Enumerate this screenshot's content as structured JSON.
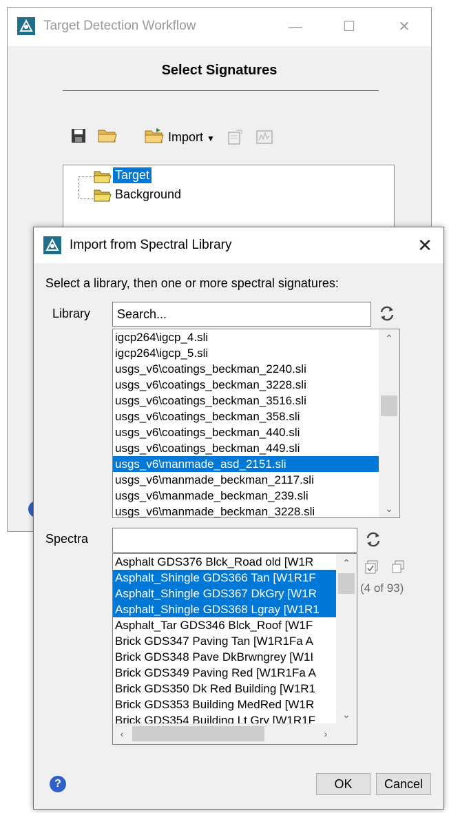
{
  "main_window": {
    "title": "Target Detection Workflow",
    "heading": "Select Signatures",
    "toolbar": {
      "import_label": "Import"
    },
    "tree": {
      "items": [
        {
          "label": "Target",
          "selected": true
        },
        {
          "label": "Background",
          "selected": false
        }
      ]
    }
  },
  "dialog": {
    "title": "Import from Spectral Library",
    "instruction": "Select a library, then one or more spectral signatures:",
    "library": {
      "label": "Library",
      "search_value": "Search...",
      "items": [
        "igcp264\\igcp_4.sli",
        "igcp264\\igcp_5.sli",
        "usgs_v6\\coatings_beckman_2240.sli",
        "usgs_v6\\coatings_beckman_3228.sli",
        "usgs_v6\\coatings_beckman_3516.sli",
        "usgs_v6\\coatings_beckman_358.sli",
        "usgs_v6\\coatings_beckman_440.sli",
        "usgs_v6\\coatings_beckman_449.sli",
        "usgs_v6\\manmade_asd_2151.sli",
        "usgs_v6\\manmade_beckman_2117.sli",
        "usgs_v6\\manmade_beckman_239.sli",
        "usgs_v6\\manmade_beckman_3228.sli"
      ],
      "selected_index": 8
    },
    "spectra": {
      "label": "Spectra",
      "filter_value": "",
      "items": [
        "Asphalt GDS376 Blck_Road old [W1R",
        "Asphalt_Shingle GDS366 Tan [W1R1F",
        "Asphalt_Shingle GDS367 DkGry [W1R",
        "Asphalt_Shingle GDS368 Lgray [W1R1",
        "Asphalt_Tar GDS346 Blck_Roof [W1F",
        "Brick GDS347 Paving Tan [W1R1Fa A",
        "Brick GDS348 Pave DkBrwngrey [W1I",
        "Brick GDS349 Paving Red [W1R1Fa A",
        "Brick GDS350 Dk Red Building [W1R1",
        "Brick GDS353 Building MedRed [W1R",
        "Brick GDS354 Building Lt Gry [W1R1F"
      ],
      "selected_indices": [
        1,
        2,
        3
      ],
      "count_text": "(4 of 93)"
    },
    "buttons": {
      "ok": "OK",
      "cancel": "Cancel"
    }
  },
  "colors": {
    "selection": "#0078d7",
    "heading_rule": "#3b6fd6",
    "help": "#2f5fc7"
  }
}
